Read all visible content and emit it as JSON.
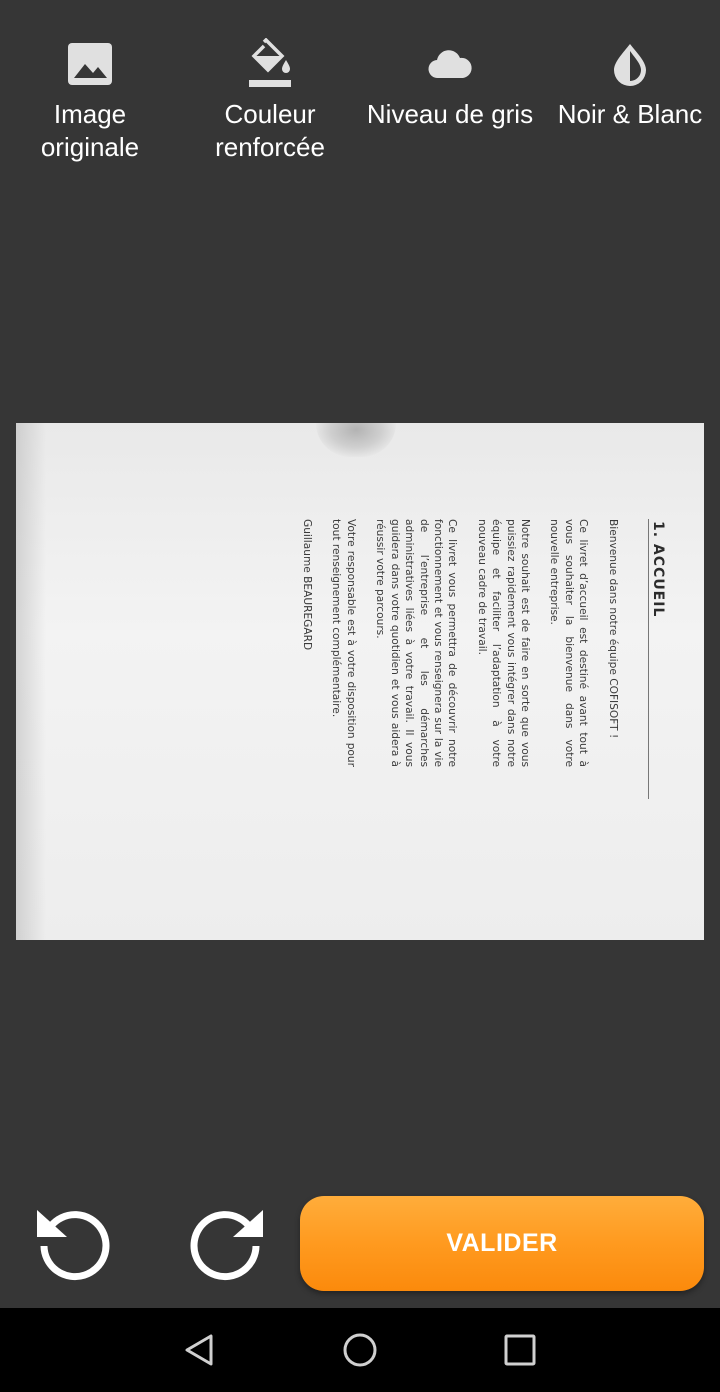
{
  "filters": [
    {
      "icon": "image-icon",
      "label": "Image\noriginale"
    },
    {
      "icon": "paint-bucket-icon",
      "label": "Couleur\nrenforcée"
    },
    {
      "icon": "cloud-icon",
      "label": "Niveau de gris"
    },
    {
      "icon": "drop-icon",
      "label": "Noir & Blanc"
    }
  ],
  "document": {
    "title": "1. ACCUEIL",
    "paragraphs": [
      "Bienvenue dans notre équipe COFISOFT !",
      "Ce livret d’accueil est destiné avant tout à vous souhaiter la bienvenue dans votre nouvelle entreprise.",
      "Notre souhait est de faire en sorte que vous puissiez rapidement vous intégrer dans notre équipe et faciliter l’adaptation à votre nouveau cadre de travail.",
      "Ce livret vous permettra de découvrir notre fonctionnement et vous renseignera sur la vie de l’entreprise et les démarches administratives liées à votre travail. Il vous guidera dans votre quotidien et vous aidera à réussir votre parcours.",
      "Votre responsable est à votre disposition pour tout renseignement complémentaire."
    ],
    "signature": "Guillaume BEAUREGARD"
  },
  "controls": {
    "rotate_left_icon": "rotate-left-icon",
    "rotate_right_icon": "rotate-right-icon",
    "validate_label": "VALIDER",
    "validate_color": "#ff9a1f"
  },
  "navbar": {
    "back_icon": "back-triangle-icon",
    "home_icon": "home-circle-icon",
    "recent_icon": "recent-square-icon"
  }
}
